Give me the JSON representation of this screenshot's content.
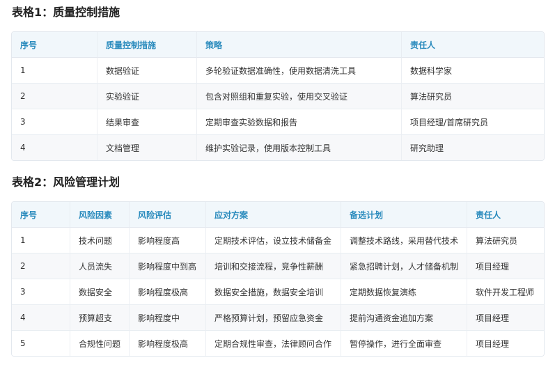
{
  "table1": {
    "title": "表格1：质量控制措施",
    "headers": [
      "序号",
      "质量控制措施",
      "策略",
      "责任人"
    ],
    "rows": [
      [
        "1",
        "数据验证",
        "多轮验证数据准确性，使用数据清洗工具",
        "数据科学家"
      ],
      [
        "2",
        "实验验证",
        "包含对照组和重复实验，使用交叉验证",
        "算法研究员"
      ],
      [
        "3",
        "结果审查",
        "定期审查实验数据和报告",
        "项目经理/首席研究员"
      ],
      [
        "4",
        "文档管理",
        "维护实验记录，使用版本控制工具",
        "研究助理"
      ]
    ]
  },
  "table2": {
    "title": "表格2：风险管理计划",
    "headers": [
      "序号",
      "风险因素",
      "风险评估",
      "应对方案",
      "备选计划",
      "责任人"
    ],
    "rows": [
      [
        "1",
        "技术问题",
        "影响程度高",
        "定期技术评估，设立技术储备金",
        "调整技术路线，采用替代技术",
        "算法研究员"
      ],
      [
        "2",
        "人员流失",
        "影响程度中到高",
        "培训和交接流程，竞争性薪酬",
        "紧急招聘计划，人才储备机制",
        "项目经理"
      ],
      [
        "3",
        "数据安全",
        "影响程度极高",
        "数据安全措施，数据安全培训",
        "定期数据恢复演练",
        "软件开发工程师"
      ],
      [
        "4",
        "预算超支",
        "影响程度中",
        "严格预算计划，预留应急资金",
        "提前沟通资金追加方案",
        "项目经理"
      ],
      [
        "5",
        "合规性问题",
        "影响程度极高",
        "定期合规性审查，法律顾问合作",
        "暂停操作，进行全面审查",
        "项目经理"
      ]
    ]
  }
}
